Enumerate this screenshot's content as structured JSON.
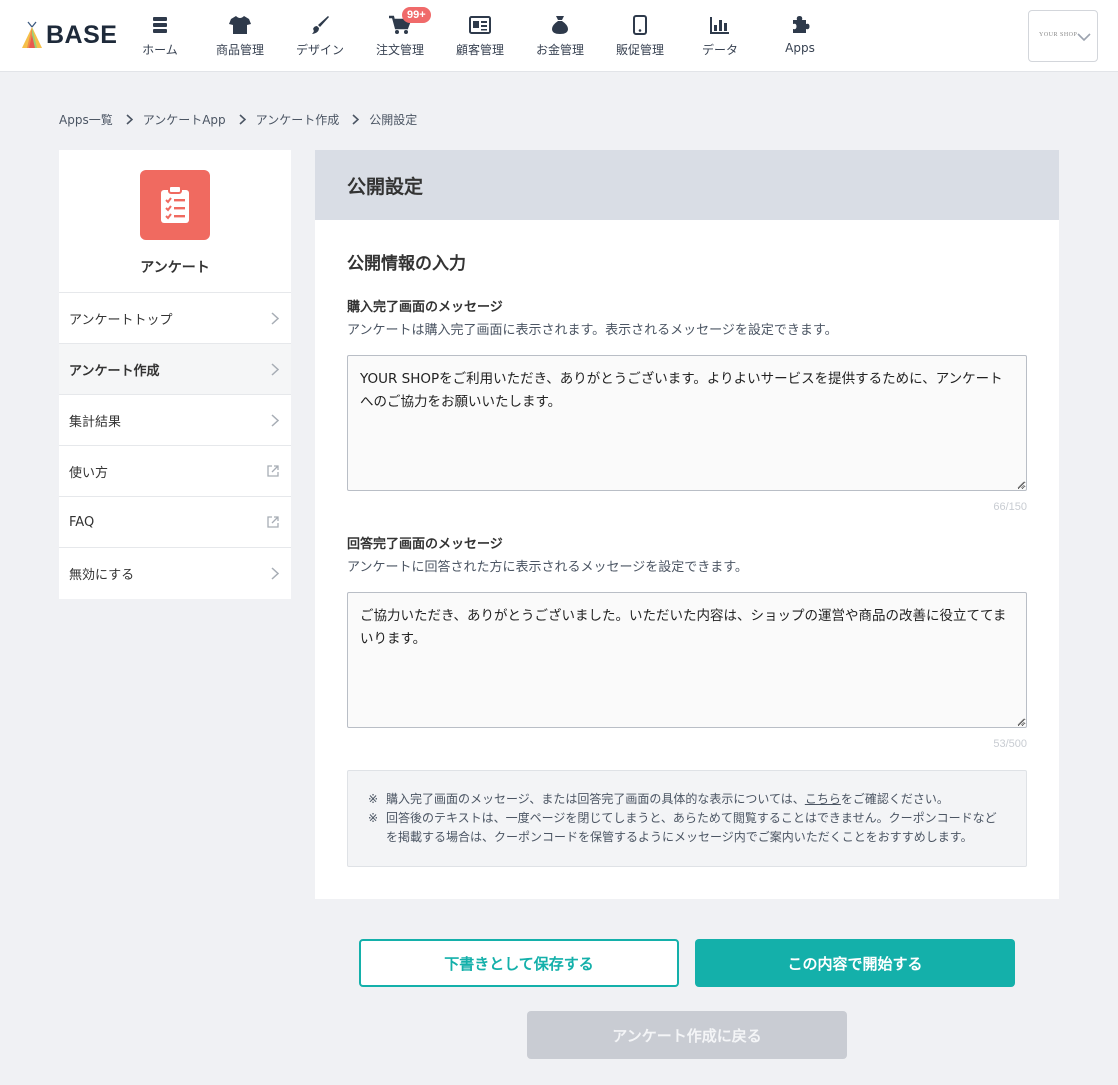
{
  "header": {
    "logo_text": "BASE",
    "nav": [
      {
        "label": "ホーム",
        "icon": "server-stack-icon"
      },
      {
        "label": "商品管理",
        "icon": "tshirt-icon"
      },
      {
        "label": "デザイン",
        "icon": "paintbrush-icon"
      },
      {
        "label": "注文管理",
        "icon": "cart-icon",
        "badge": "99+"
      },
      {
        "label": "顧客管理",
        "icon": "id-card-icon"
      },
      {
        "label": "お金管理",
        "icon": "money-bag-icon"
      },
      {
        "label": "販促管理",
        "icon": "smartphone-icon"
      },
      {
        "label": "データ",
        "icon": "bar-chart-icon"
      },
      {
        "label": "Apps",
        "icon": "puzzle-icon"
      }
    ],
    "shop_logo_text": "YOUR SHOP"
  },
  "breadcrumb": {
    "items": [
      "Apps一覧",
      "アンケートApp",
      "アンケート作成"
    ],
    "current": "公開設定"
  },
  "sidebar": {
    "app_name": "アンケート",
    "items": [
      {
        "label": "アンケートトップ",
        "icon": "chevron-right-icon",
        "active": false
      },
      {
        "label": "アンケート作成",
        "icon": "chevron-right-icon",
        "active": true
      },
      {
        "label": "集計結果",
        "icon": "chevron-right-icon",
        "active": false
      },
      {
        "label": "使い方",
        "icon": "external-link-icon",
        "active": false
      },
      {
        "label": "FAQ",
        "icon": "external-link-icon",
        "active": false
      },
      {
        "label": "無効にする",
        "icon": "chevron-right-icon",
        "active": false
      }
    ]
  },
  "panel": {
    "title": "公開設定",
    "section_title": "公開情報の入力",
    "purchase_message": {
      "label": "購入完了画面のメッセージ",
      "help": "アンケートは購入完了画面に表示されます。表示されるメッセージを設定できます。",
      "value": "YOUR SHOPをご利用いただき、ありがとうございます。よりよいサービスを提供するために、アンケートへのご協力をお願いいたします。",
      "counter": "66/150"
    },
    "answer_message": {
      "label": "回答完了画面のメッセージ",
      "help": "アンケートに回答された方に表示されるメッセージを設定できます。",
      "value": "ご協力いただき、ありがとうございました。いただいた内容は、ショップの運営や商品の改善に役立ててまいります。",
      "counter": "53/500"
    },
    "notice": {
      "mark": "※",
      "line1_before": "購入完了画面のメッセージ、または回答完了画面の具体的な表示については、",
      "line1_link": "こちら",
      "line1_after": "をご確認ください。",
      "line2": "回答後のテキストは、一度ページを閉じてしまうと、あらためて閲覧することはできません。クーポンコードなどを掲載する場合は、クーポンコードを保管するようにメッセージ内でご案内いただくことをおすすめします。"
    }
  },
  "buttons": {
    "draft": "下書きとして保存する",
    "start": "この内容で開始する",
    "back": "アンケート作成に戻る"
  },
  "colors": {
    "accent": "#14b0aa",
    "badge": "#f06a6a",
    "app_icon": "#f06a60"
  }
}
